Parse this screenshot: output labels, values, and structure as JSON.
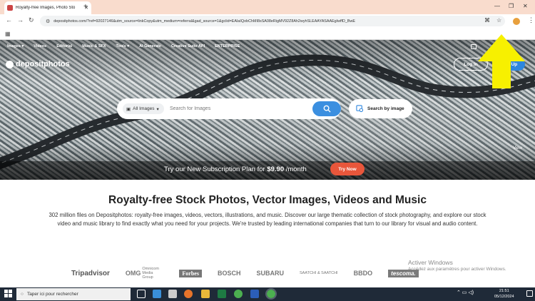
{
  "browser": {
    "tab_title": "Royalty-free Images, Photo Sto",
    "url": "depositphotos.com/?ref=92027146&utm_source=linkCopy&utm_medium=referral&gad_source=1&gclid=EAIaIQobChMI8sSA08eRigMV92Z8Ah2wyhSLEAAYASAAEgIwffD_BwE"
  },
  "site": {
    "nav": [
      "Images ▾",
      "Videos",
      "Editorial",
      "Music & SFX",
      "Tools ▾",
      "AI Generate",
      "Creative Suite API",
      "ENTERPRISE"
    ],
    "logo_text": "depositphotos",
    "login_label": "Log In",
    "signup_label": "Sign Up",
    "category_label": "All Images",
    "search_placeholder": "Search for Images",
    "search_by_image_label": "Search by image",
    "promo_prefix": "Try our New Subscription Plan for ",
    "promo_price": "$9.90",
    "promo_suffix": " /month",
    "try_now_label": "Try Now",
    "view_label": "View",
    "headline": "Royalty-free Stock Photos, Vector Images, Videos and Music",
    "description": "302 million files on Depositphotos: royalty-free images, videos, vectors, illustrations, and music. Discover our large thematic collection of stock photography, and explore our stock video and music library to find exactly what you need for your projects. We're trusted by leading international companies that turn to our library for visual and audio content.",
    "client_logos": [
      "Tripadvisor",
      "OMG",
      "Omnicom Media Group",
      "Forbes",
      "BOSCH",
      "SUBARU",
      "SAATCHI & SAATCHI",
      "BBDO",
      "tescoma."
    ]
  },
  "windows": {
    "activate_title": "Activer Windows",
    "activate_sub": "Accédez aux paramètres pour activer Windows.",
    "taskbar_search": "Taper ici pour rechercher",
    "time": "21:51",
    "date": "05/12/2024"
  },
  "colors": {
    "accent": "#2e86de",
    "promo_button": "#e8563b",
    "tab_strip": "#f9dccd",
    "annotation_arrow": "#f7f000"
  }
}
